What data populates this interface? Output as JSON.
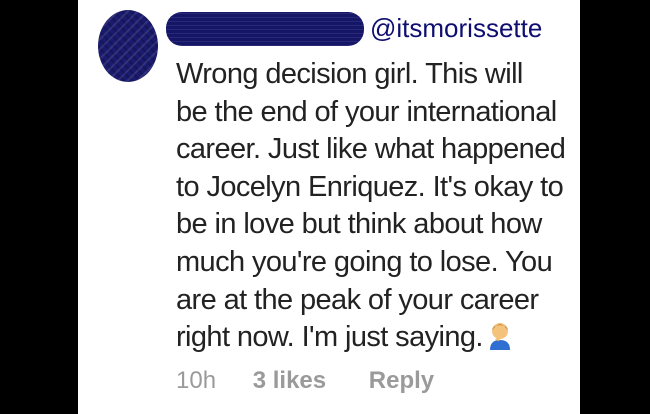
{
  "comment": {
    "username": "@itsmorissette",
    "lines": [
      "Wrong decision girl.  This will",
      "be the end of your international",
      "career.  Just like what happened",
      "to Jocelyn Enriquez.  It's okay to",
      "be in love but think about how",
      "much you're going to lose.  You",
      "are at the peak of your career",
      "right now.  I'm just saying."
    ],
    "emoji_icon": "person-facepalming-icon"
  },
  "meta": {
    "time": "10h",
    "likes": "3 likes",
    "reply_label": "Reply"
  },
  "colors": {
    "redaction": "#161668",
    "username": "#0e0e70",
    "text": "#222222",
    "meta": "#9a9a9a"
  }
}
